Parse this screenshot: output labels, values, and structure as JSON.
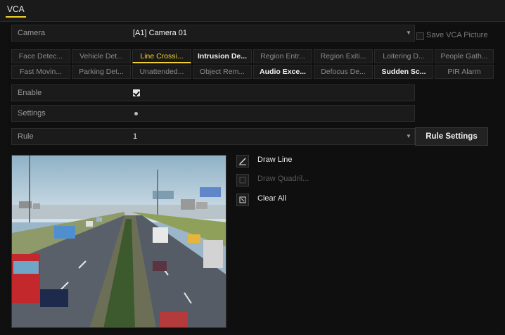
{
  "window": {
    "title": "VCA"
  },
  "camera": {
    "label": "Camera",
    "value": "[A1] Camera 01",
    "save_label": "Save VCA Picture"
  },
  "tabs": [
    {
      "label": "Face Detec...",
      "state": "normal"
    },
    {
      "label": "Vehicle Det...",
      "state": "normal"
    },
    {
      "label": "Line Crossi...",
      "state": "active"
    },
    {
      "label": "Intrusion De...",
      "state": "bold"
    },
    {
      "label": "Region Entr...",
      "state": "normal"
    },
    {
      "label": "Region Exiti...",
      "state": "normal"
    },
    {
      "label": "Loitering D...",
      "state": "normal"
    },
    {
      "label": "People Gath...",
      "state": "normal"
    },
    {
      "label": "Fast Movin...",
      "state": "normal"
    },
    {
      "label": "Parking Det...",
      "state": "normal"
    },
    {
      "label": "Unattended...",
      "state": "normal"
    },
    {
      "label": "Object Rem...",
      "state": "normal"
    },
    {
      "label": "Audio Exce...",
      "state": "bold"
    },
    {
      "label": "Defocus De...",
      "state": "normal"
    },
    {
      "label": "Sudden Sc...",
      "state": "bold"
    },
    {
      "label": "PIR Alarm",
      "state": "normal"
    }
  ],
  "enable": {
    "label": "Enable",
    "checked": true
  },
  "settings": {
    "label": "Settings"
  },
  "rule": {
    "label": "Rule",
    "value": "1",
    "button_label": "Rule Settings"
  },
  "tools": {
    "draw_line": "Draw Line",
    "draw_quad": "Draw Quadril...",
    "clear_all": "Clear All"
  },
  "colors": {
    "accent": "#f2d12c",
    "background": "#101010"
  }
}
